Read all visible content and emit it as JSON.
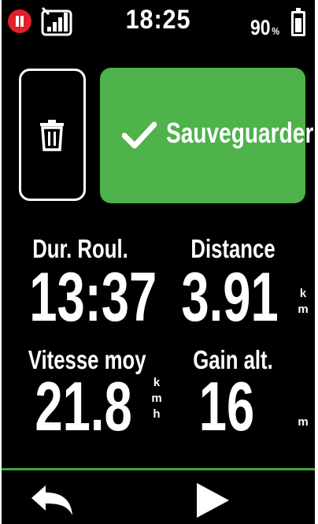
{
  "status_bar": {
    "time": "18:25",
    "battery_percent": "90",
    "battery_unit": "%"
  },
  "actions": {
    "save_label": "Sauveguarder"
  },
  "metrics": {
    "ride_time": {
      "label": "Dur. Roul.",
      "value": "13:37"
    },
    "distance": {
      "label": "Distance",
      "value": "3.91",
      "unit_chars": [
        "k",
        "m"
      ]
    },
    "avg_speed": {
      "label": "Vitesse moy",
      "value": "21.8",
      "unit_chars": [
        "k",
        "m",
        "h"
      ]
    },
    "elevation_gain": {
      "label": "Gain alt.",
      "value": "16",
      "unit": "m"
    }
  },
  "colors": {
    "accent": "#4db34a",
    "record": "#e0202a",
    "background": "#000000"
  },
  "icons": [
    "record-pause-icon",
    "signal-icon",
    "battery-icon",
    "trash-icon",
    "check-icon",
    "back-arrow-icon",
    "play-icon"
  ]
}
